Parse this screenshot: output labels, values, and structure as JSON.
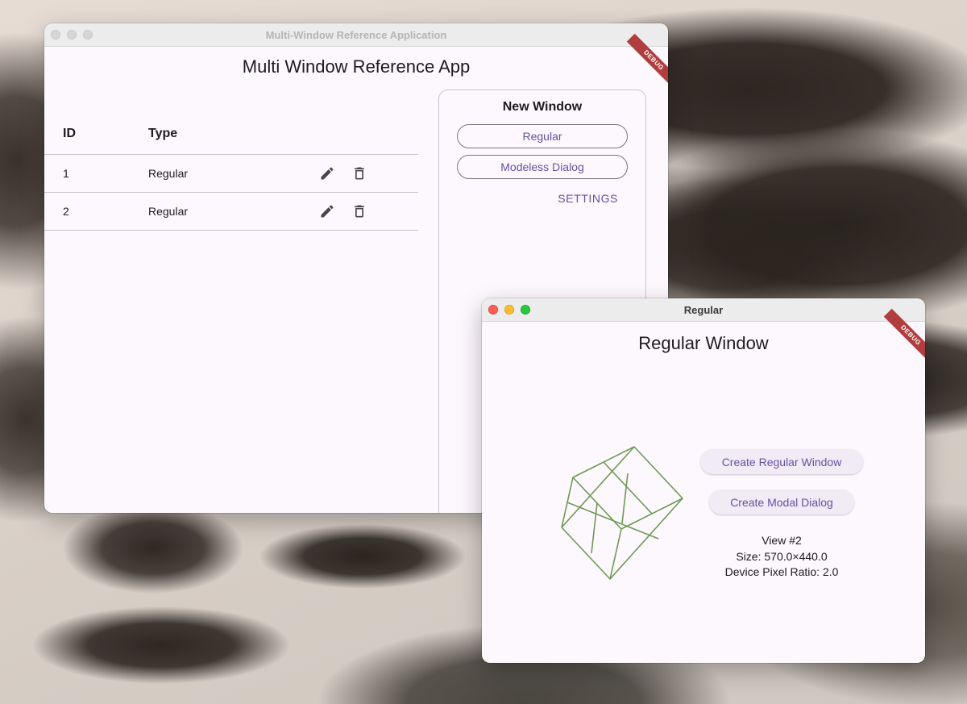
{
  "main_window": {
    "window_title": "Multi-Window Reference Application",
    "app_title": "Multi Window Reference App",
    "debug_banner": "DEBUG",
    "table": {
      "headers": {
        "id": "ID",
        "type": "Type"
      },
      "rows": [
        {
          "id": "1",
          "type": "Regular",
          "actions": [
            "edit-icon",
            "delete-icon"
          ]
        },
        {
          "id": "2",
          "type": "Regular",
          "actions": [
            "edit-icon",
            "delete-icon"
          ]
        }
      ]
    },
    "new_window_panel": {
      "title": "New Window",
      "buttons": {
        "regular": "Regular",
        "modeless_dialog": "Modeless Dialog"
      },
      "settings_label": "SETTINGS"
    }
  },
  "regular_window": {
    "window_title": "Regular",
    "title": "Regular Window",
    "debug_banner": "DEBUG",
    "graphic": "wireframe-cube",
    "buttons": {
      "create_regular": "Create Regular Window",
      "create_modal": "Create Modal Dialog"
    },
    "info": {
      "view": "View #2",
      "size": "Size: 570.0×440.0",
      "pixel_ratio": "Device Pixel Ratio: 2.0"
    }
  },
  "colors": {
    "accent": "#6750a4",
    "surface": "#fdf7fe",
    "outline": "#79747e",
    "divider": "#cac4d0",
    "cube_stroke": "#6e9a55",
    "debug_ribbon": "#b13e3e"
  }
}
